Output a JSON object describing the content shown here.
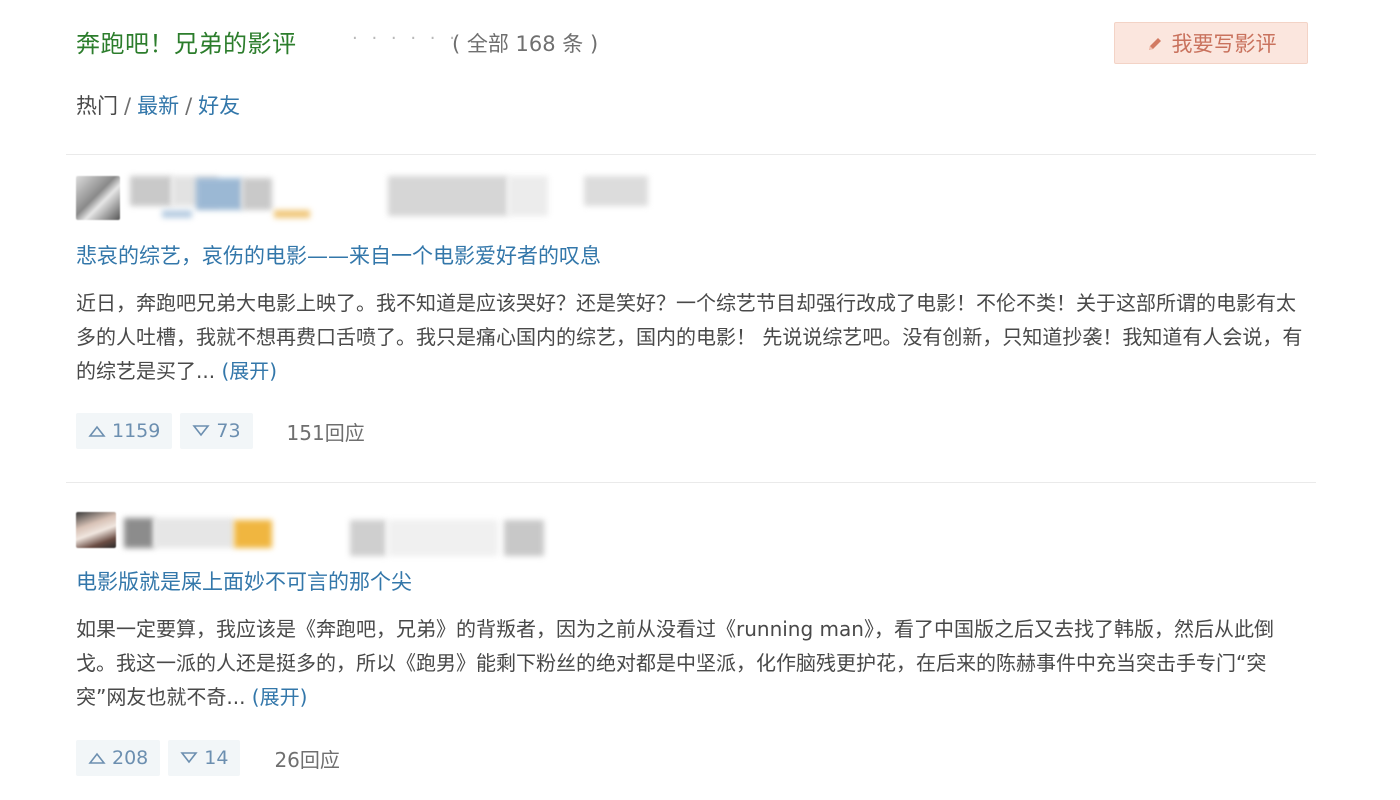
{
  "header": {
    "title": "奔跑吧！兄弟的影评",
    "dots": "· · · · · ·",
    "count": "( 全部 168 条 )",
    "write_button": "我要写影评"
  },
  "sort_tabs": {
    "hot": "热门",
    "sep1": "/",
    "latest": "最新",
    "sep2": "/",
    "friends": "好友"
  },
  "reviews": [
    {
      "title": "悲哀的综艺，哀伤的电影——来自一个电影爱好者的叹息",
      "body": "近日，奔跑吧兄弟大电影上映了。我不知道是应该哭好？还是笑好？一个综艺节目却强行改成了电影！不伦不类！关于这部所谓的电影有太多的人吐槽，我就不想再费口舌喷了。我只是痛心国内的综艺，国内的电影！ 先说说综艺吧。没有创新，只知道抄袭！我知道有人会说，有的综艺是买了...",
      "expand": "(展开)",
      "useful": "1159",
      "useless": "73",
      "replies": "151回应"
    },
    {
      "title": "电影版就是屎上面妙不可言的那个尖",
      "body": "如果一定要算，我应该是《奔跑吧，兄弟》的背叛者，因为之前从没看过《running man》，看了中国版之后又去找了韩版，然后从此倒戈。我这一派的人还是挺多的，所以《跑男》能剩下粉丝的绝对都是中坚派，化作脑残更护花，在后来的陈赫事件中充当突击手专门“突突”网友也就不奇...",
      "expand": "(展开)",
      "useful": "208",
      "useless": "14",
      "replies": "26回应"
    }
  ],
  "colors": {
    "title_green": "#2c7d2c",
    "link_blue": "#3377aa",
    "button_bg": "#fbe6de",
    "button_text": "#c9725d",
    "vote_bg": "#f2f6f8"
  },
  "icons": {
    "write": "pencil-icon",
    "up": "thumbs-up-triangle-icon",
    "down": "thumbs-down-triangle-icon"
  }
}
